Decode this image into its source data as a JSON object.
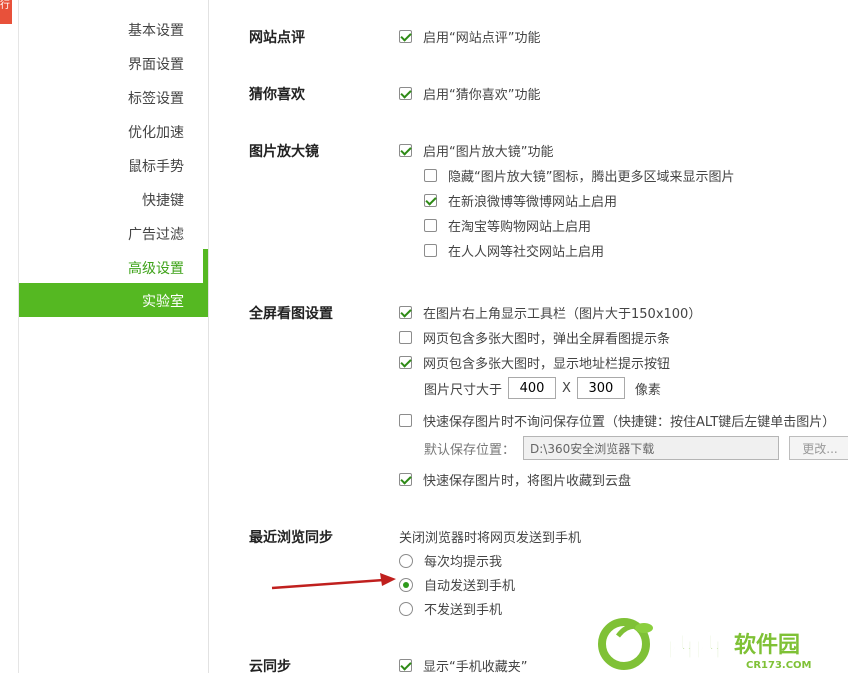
{
  "left_strip": {
    "tab_text": "行"
  },
  "sidebar": {
    "items": [
      {
        "label": "基本设置"
      },
      {
        "label": "界面设置"
      },
      {
        "label": "标签设置"
      },
      {
        "label": "优化加速"
      },
      {
        "label": "鼠标手势"
      },
      {
        "label": "快捷键"
      },
      {
        "label": "广告过滤"
      },
      {
        "label": "高级设置"
      },
      {
        "label": "实验室"
      }
    ]
  },
  "sections": {
    "review": {
      "title": "网站点评",
      "enable": {
        "label": "启用“网站点评”功能",
        "checked": true
      }
    },
    "guess": {
      "title": "猜你喜欢",
      "enable": {
        "label": "启用“猜你喜欢”功能",
        "checked": true
      }
    },
    "magnifier": {
      "title": "图片放大镜",
      "enable": {
        "label": "启用“图片放大镜”功能",
        "checked": true
      },
      "options": [
        {
          "label": "隐藏“图片放大镜”图标，腾出更多区域来显示图片",
          "checked": false
        },
        {
          "label": "在新浪微博等微博网站上启用",
          "checked": true
        },
        {
          "label": "在淘宝等购物网站上启用",
          "checked": false
        },
        {
          "label": "在人人网等社交网站上启用",
          "checked": false
        }
      ]
    },
    "fullscreen": {
      "title": "全屏看图设置",
      "opt1": {
        "label": "在图片右上角显示工具栏（图片大于150x100）",
        "checked": true
      },
      "opt2": {
        "label": "网页包含多张大图时，弹出全屏看图提示条",
        "checked": false
      },
      "opt3": {
        "label": "网页包含多张大图时，显示地址栏提示按钮",
        "checked": true
      },
      "size_label": "图片尺寸大于",
      "width": "400",
      "times": "X",
      "height": "300",
      "unit": "像素",
      "opt4": {
        "label": "快速保存图片时不询问保存位置（快捷键：按住ALT键后左键单击图片）",
        "checked": false
      },
      "save_path_label": "默认保存位置：",
      "save_path": "D:\\360安全浏览器下载",
      "change_button": "更改...",
      "opt5": {
        "label": "快速保存图片时，将图片收藏到云盘",
        "checked": true
      }
    },
    "recent_sync": {
      "title": "最近浏览同步",
      "description": "关闭浏览器时将网页发送到手机",
      "radios": [
        {
          "label": "每次均提示我",
          "checked": false
        },
        {
          "label": "自动发送到手机",
          "checked": true
        },
        {
          "label": "不发送到手机",
          "checked": false
        }
      ]
    },
    "cloud_sync": {
      "title": "云同步",
      "opt1": {
        "label": "显示“手机收藏夹”",
        "checked": true
      }
    }
  },
  "watermark": {
    "name": "西西软件园",
    "domain": "CR173.COM"
  },
  "colors": {
    "accent_green": "#55b822",
    "check_green": "#2e8a16",
    "arrow_red": "#c0201e"
  }
}
